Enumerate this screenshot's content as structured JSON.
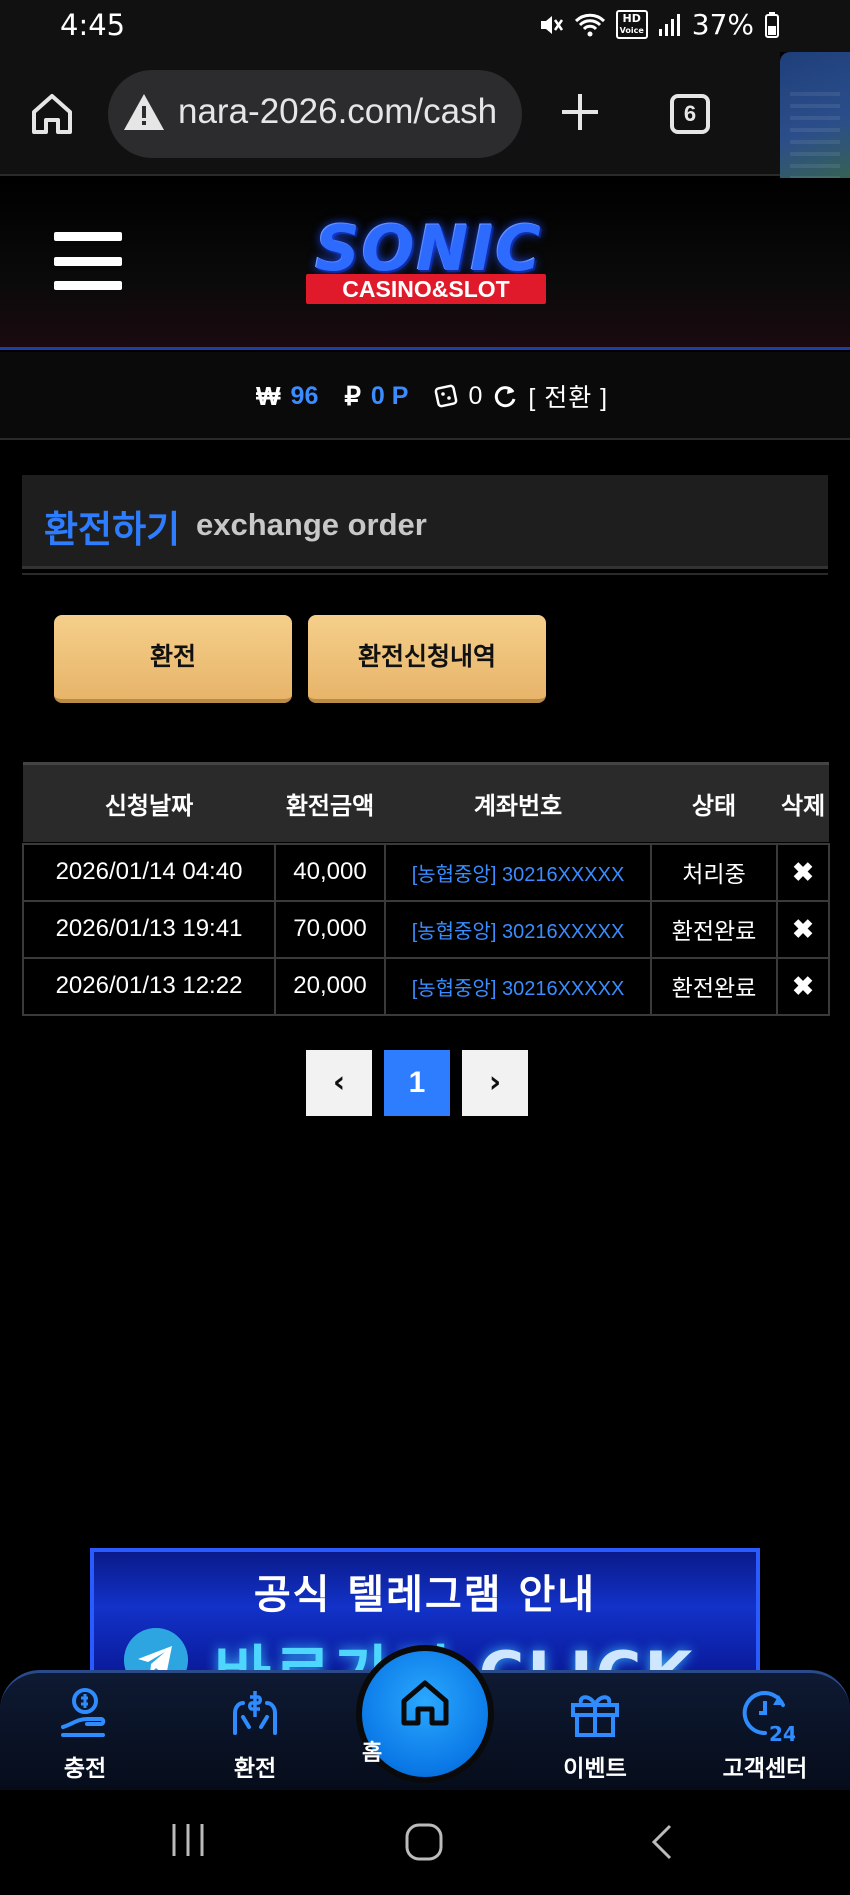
{
  "status_bar": {
    "time": "4:45",
    "battery": "37%",
    "hd_top": "HD",
    "hd_bottom": "Voice"
  },
  "browser": {
    "url": "nara-2026.com/cash",
    "tab_count": "6"
  },
  "site": {
    "logo_main": "SONIC",
    "logo_sub": "CASINO&SLOT"
  },
  "balance": {
    "won_symbol": "₩",
    "won_value": "96",
    "point_symbol": "₽",
    "point_value": "0 P",
    "chips_value": "0",
    "convert_label": "[ 전환 ]"
  },
  "section": {
    "title_ko": "환전하기",
    "title_en": "exchange order"
  },
  "buttons": {
    "exchange": "환전",
    "history": "환전신청내역"
  },
  "table": {
    "headers": [
      "신청날짜",
      "환전금액",
      "계좌번호",
      "상태",
      "삭제"
    ],
    "rows": [
      {
        "date": "2026/01/14 04:40",
        "amount": "40,000",
        "account": "[농협중앙] 30216XXXXX",
        "status": "처리중",
        "delete": "✖"
      },
      {
        "date": "2026/01/13 19:41",
        "amount": "70,000",
        "account": "[농협중앙] 30216XXXXX",
        "status": "환전완료",
        "delete": "✖"
      },
      {
        "date": "2026/01/13 12:22",
        "amount": "20,000",
        "account": "[농협중앙] 30216XXXXX",
        "status": "환전완료",
        "delete": "✖"
      }
    ]
  },
  "pagination": {
    "prev": "‹",
    "current": "1",
    "next": "›"
  },
  "banner": {
    "line1": "공식 텔레그램 안내",
    "line2_ko": "바로가기",
    "line2_en": "CLICK"
  },
  "bottom_nav": {
    "charge": "충전",
    "exchange": "환전",
    "home": "홈",
    "event": "이벤트",
    "support": "고객센터",
    "support_badge": "24"
  },
  "colors": {
    "accent_blue": "#2e7dff",
    "gold_button": "#f0c27a",
    "background": "#000000"
  }
}
